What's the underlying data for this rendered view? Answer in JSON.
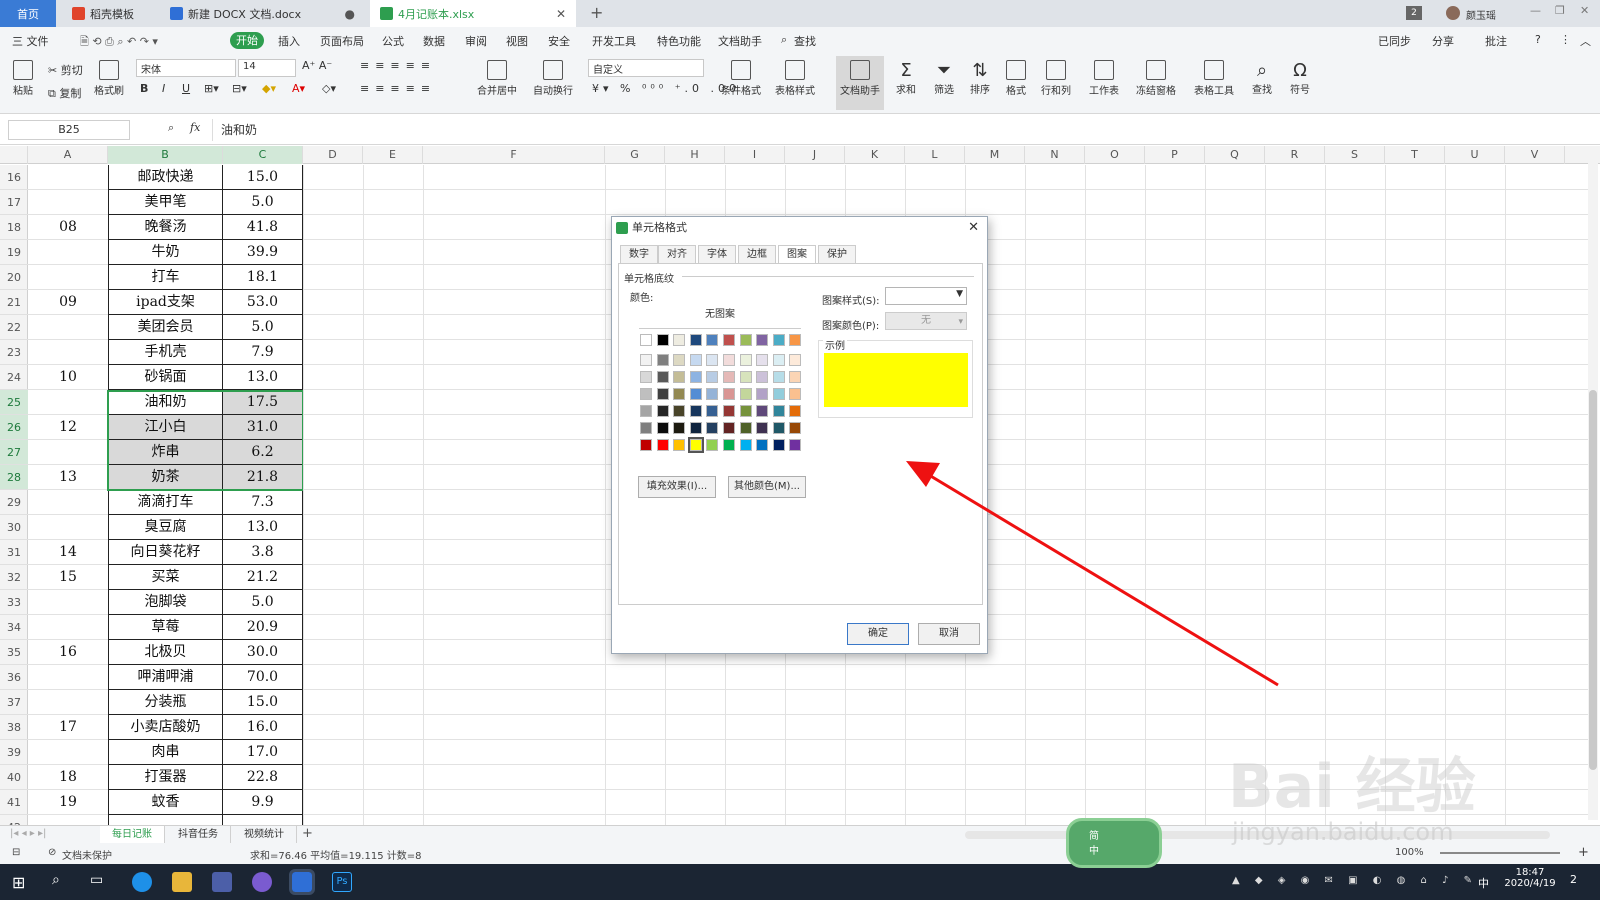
{
  "titlebar": {
    "tabs": [
      "首页",
      "稻壳模板",
      "新建 DOCX 文档.docx",
      "4月记账本.xlsx"
    ],
    "badge": "2",
    "user": "颜玉瑶"
  },
  "menu": {
    "file": "三 文件",
    "items": [
      "开始",
      "插入",
      "页面布局",
      "公式",
      "数据",
      "审阅",
      "视图",
      "安全",
      "开发工具",
      "特色功能",
      "文档助手",
      "查找"
    ],
    "right": [
      "已同步",
      "分享",
      "批注"
    ]
  },
  "ribbon": {
    "paste": "粘贴",
    "cut": "剪切",
    "copy": "复制",
    "format_painter": "格式刷",
    "font_name": "宋体",
    "font_size": "14",
    "merge": "合并居中",
    "wrap": "自动换行",
    "number_format": "自定义",
    "cond_format": "条件格式",
    "table_style": "表格样式",
    "doc_helper": "文档助手",
    "sum": "求和",
    "filter": "筛选",
    "sort": "排序",
    "format": "格式",
    "rowcol": "行和列",
    "sheet": "工作表",
    "freeze": "冻结窗格",
    "table_tool": "表格工具",
    "find": "查找",
    "symbol": "符号"
  },
  "formula": {
    "name_box": "B25",
    "fx": "fx",
    "content": "油和奶"
  },
  "columns": [
    "A",
    "B",
    "C",
    "D",
    "E",
    "F",
    "G",
    "H",
    "I",
    "J",
    "K",
    "L",
    "M",
    "N",
    "O",
    "P",
    "Q",
    "R",
    "S",
    "T",
    "U",
    "V"
  ],
  "rows": [
    {
      "n": "16",
      "a": "",
      "b": "邮政快递",
      "c": "15.0"
    },
    {
      "n": "17",
      "a": "",
      "b": "美甲笔",
      "c": "5.0"
    },
    {
      "n": "18",
      "a": "08",
      "b": "晚餐汤",
      "c": "41.8"
    },
    {
      "n": "19",
      "a": "",
      "b": "牛奶",
      "c": "39.9"
    },
    {
      "n": "20",
      "a": "",
      "b": "打车",
      "c": "18.1"
    },
    {
      "n": "21",
      "a": "09",
      "b": "ipad支架",
      "c": "53.0"
    },
    {
      "n": "22",
      "a": "",
      "b": "美团会员",
      "c": "5.0"
    },
    {
      "n": "23",
      "a": "",
      "b": "手机壳",
      "c": "7.9"
    },
    {
      "n": "24",
      "a": "10",
      "b": "砂锅面",
      "c": "13.0"
    },
    {
      "n": "25",
      "a": "",
      "b": "油和奶",
      "c": "17.5"
    },
    {
      "n": "26",
      "a": "12",
      "b": "江小白",
      "c": "31.0"
    },
    {
      "n": "27",
      "a": "",
      "b": "炸串",
      "c": "6.2"
    },
    {
      "n": "28",
      "a": "13",
      "b": "奶茶",
      "c": "21.8"
    },
    {
      "n": "29",
      "a": "",
      "b": "滴滴打车",
      "c": "7.3"
    },
    {
      "n": "30",
      "a": "",
      "b": "臭豆腐",
      "c": "13.0"
    },
    {
      "n": "31",
      "a": "14",
      "b": "向日葵花籽",
      "c": "3.8"
    },
    {
      "n": "32",
      "a": "15",
      "b": "买菜",
      "c": "21.2"
    },
    {
      "n": "33",
      "a": "",
      "b": "泡脚袋",
      "c": "5.0"
    },
    {
      "n": "34",
      "a": "",
      "b": "草莓",
      "c": "20.9"
    },
    {
      "n": "35",
      "a": "16",
      "b": "北极贝",
      "c": "30.0"
    },
    {
      "n": "36",
      "a": "",
      "b": "呷浦呷浦",
      "c": "70.0"
    },
    {
      "n": "37",
      "a": "",
      "b": "分装瓶",
      "c": "15.0"
    },
    {
      "n": "38",
      "a": "17",
      "b": "小卖店酸奶",
      "c": "16.0"
    },
    {
      "n": "39",
      "a": "",
      "b": "肉串",
      "c": "17.0"
    },
    {
      "n": "40",
      "a": "18",
      "b": "打蛋器",
      "c": "22.8"
    },
    {
      "n": "41",
      "a": "19",
      "b": "蚊香",
      "c": "9.9"
    },
    {
      "n": "42",
      "a": "",
      "b": "",
      "c": ""
    }
  ],
  "sheets": [
    "每日记账",
    "抖音任务",
    "视频统计"
  ],
  "status": {
    "protect": "文档未保护",
    "summary": "求和=76.46  平均值=19.115  计数=8",
    "zoom": "100%"
  },
  "taskbar": {
    "time": "18:47",
    "date": "2020/4/19",
    "ime": "中",
    "notify": "2"
  },
  "dialog": {
    "title": "单元格格式",
    "tabs": [
      "数字",
      "对齐",
      "字体",
      "边框",
      "图案",
      "保护"
    ],
    "section": "单元格底纹",
    "color_label": "颜色:",
    "no_pattern": "无图案",
    "pattern_style_label": "图案样式(S):",
    "pattern_color_label": "图案颜色(P):",
    "pattern_color_value": "无",
    "sample_label": "示例",
    "sample_color": "#ffff00",
    "fill_effects": "填充效果(I)...",
    "more_colors": "其他颜色(M)...",
    "ok": "确定",
    "cancel": "取消"
  },
  "watermark": {
    "text": "Bai 经验",
    "url": "jingyan.baidu.com"
  },
  "ime_widget": {
    "line1": "简",
    "line2": "中"
  },
  "colors": {
    "accent_green": "#2e9e4f",
    "selection_gray": "#d9d9d9",
    "arrow_red": "#ee1111",
    "home_tab": "#3a7bd5"
  }
}
